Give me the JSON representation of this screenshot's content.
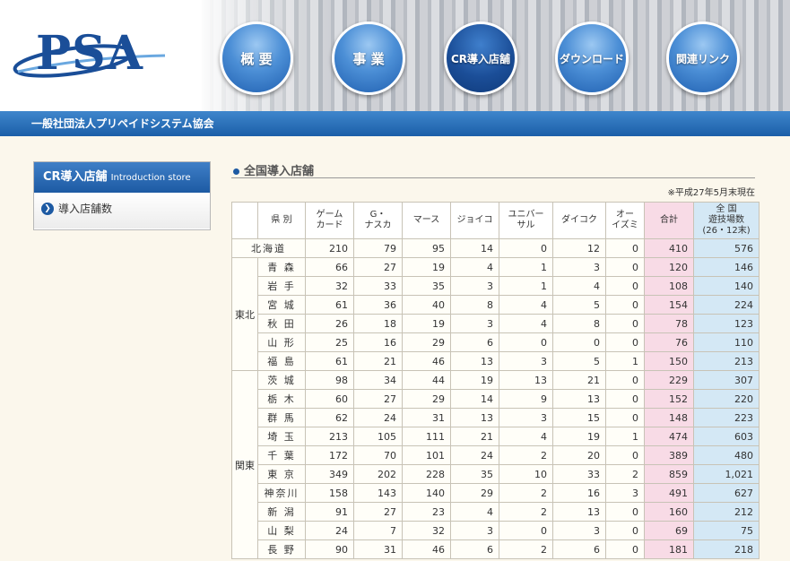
{
  "header": {
    "logo_text": "PSA",
    "nav": [
      {
        "label": "概 要"
      },
      {
        "label": "事 業"
      },
      {
        "label": "CR導入店舗"
      },
      {
        "label": "ダウンロード"
      },
      {
        "label": "関連リンク"
      }
    ],
    "org_name": "一般社団法人プリペイドシステム協会"
  },
  "sidebar": {
    "heading": "CR導入店舗",
    "heading_en": "Introduction store",
    "items": [
      {
        "label": "導入店舗数"
      }
    ]
  },
  "main": {
    "section_title": "全国導入店舗",
    "as_of": "※平成27年5月末現在",
    "table": {
      "headers": [
        "県 別",
        "ゲーム\nカード",
        "G・\nナスカ",
        "マース",
        "ジョイコ",
        "ユニバー\nサル",
        "ダイコク",
        "オー\nイズミ",
        "合計",
        "全 国\n遊技場数\n(26・12末)"
      ],
      "rows": [
        {
          "region": "",
          "pref": "北海道",
          "v": [
            "210",
            "79",
            "95",
            "14",
            "0",
            "12",
            "0",
            "410",
            "576"
          ]
        },
        {
          "region": "東北",
          "pref": "青 森",
          "v": [
            "66",
            "27",
            "19",
            "4",
            "1",
            "3",
            "0",
            "120",
            "146"
          ]
        },
        {
          "region": "",
          "pref": "岩 手",
          "v": [
            "32",
            "33",
            "35",
            "3",
            "1",
            "4",
            "0",
            "108",
            "140"
          ]
        },
        {
          "region": "",
          "pref": "宮 城",
          "v": [
            "61",
            "36",
            "40",
            "8",
            "4",
            "5",
            "0",
            "154",
            "224"
          ]
        },
        {
          "region": "",
          "pref": "秋 田",
          "v": [
            "26",
            "18",
            "19",
            "3",
            "4",
            "8",
            "0",
            "78",
            "123"
          ]
        },
        {
          "region": "",
          "pref": "山 形",
          "v": [
            "25",
            "16",
            "29",
            "6",
            "0",
            "0",
            "0",
            "76",
            "110"
          ]
        },
        {
          "region": "",
          "pref": "福 島",
          "v": [
            "61",
            "21",
            "46",
            "13",
            "3",
            "5",
            "1",
            "150",
            "213"
          ]
        },
        {
          "region": "関東",
          "pref": "茨 城",
          "v": [
            "98",
            "34",
            "44",
            "19",
            "13",
            "21",
            "0",
            "229",
            "307"
          ]
        },
        {
          "region": "",
          "pref": "栃 木",
          "v": [
            "60",
            "27",
            "29",
            "14",
            "9",
            "13",
            "0",
            "152",
            "220"
          ]
        },
        {
          "region": "",
          "pref": "群 馬",
          "v": [
            "62",
            "24",
            "31",
            "13",
            "3",
            "15",
            "0",
            "148",
            "223"
          ]
        },
        {
          "region": "",
          "pref": "埼 玉",
          "v": [
            "213",
            "105",
            "111",
            "21",
            "4",
            "19",
            "1",
            "474",
            "603"
          ]
        },
        {
          "region": "",
          "pref": "千 葉",
          "v": [
            "172",
            "70",
            "101",
            "24",
            "2",
            "20",
            "0",
            "389",
            "480"
          ]
        },
        {
          "region": "",
          "pref": "東 京",
          "v": [
            "349",
            "202",
            "228",
            "35",
            "10",
            "33",
            "2",
            "859",
            "1,021"
          ]
        },
        {
          "region": "",
          "pref": "神奈川",
          "v": [
            "158",
            "143",
            "140",
            "29",
            "2",
            "16",
            "3",
            "491",
            "627"
          ]
        },
        {
          "region": "",
          "pref": "新 潟",
          "v": [
            "91",
            "27",
            "23",
            "4",
            "2",
            "13",
            "0",
            "160",
            "212"
          ]
        },
        {
          "region": "",
          "pref": "山 梨",
          "v": [
            "24",
            "7",
            "32",
            "3",
            "0",
            "3",
            "0",
            "69",
            "75"
          ]
        },
        {
          "region": "",
          "pref": "長 野",
          "v": [
            "90",
            "31",
            "46",
            "6",
            "2",
            "6",
            "0",
            "181",
            "218"
          ]
        }
      ]
    }
  }
}
